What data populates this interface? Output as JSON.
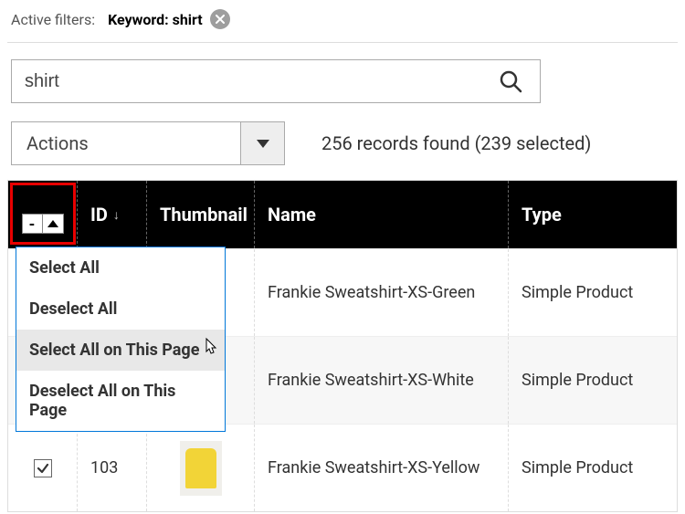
{
  "filters": {
    "label": "Active filters:",
    "chip_label": "Keyword: shirt"
  },
  "search": {
    "value": "shirt"
  },
  "actions": {
    "label": "Actions"
  },
  "status": {
    "text": "256 records found (239 selected)"
  },
  "columns": {
    "id": "ID",
    "thumbnail": "Thumbnail",
    "name": "Name",
    "type": "Type"
  },
  "select_menu": {
    "items": [
      "Select All",
      "Deselect All",
      "Select All on This Page",
      "Deselect All on This Page"
    ],
    "hover_index": 2
  },
  "rows": [
    {
      "id": "",
      "name": "Frankie  Sweatshirt-XS-Green",
      "type": "Simple Product",
      "thumb_color": "",
      "checked": false
    },
    {
      "id": "",
      "name": "Frankie  Sweatshirt-XS-White",
      "type": "Simple Product",
      "thumb_color": "white",
      "checked": false
    },
    {
      "id": "103",
      "name": "Frankie  Sweatshirt-XS-Yellow",
      "type": "Simple Product",
      "thumb_color": "yellow",
      "checked": true
    }
  ]
}
